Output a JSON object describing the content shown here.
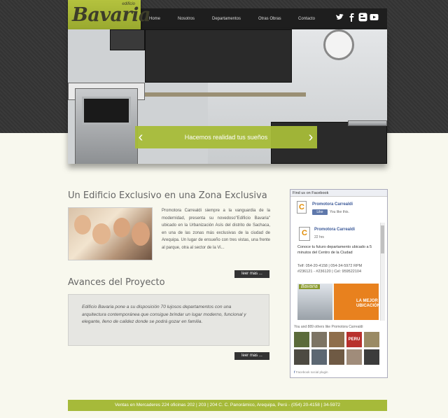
{
  "brand": {
    "name": "Bavaria",
    "tagline": "edificio"
  },
  "nav": {
    "items": [
      "Home",
      "Nosotros",
      "Departamentos",
      "Otras Obras",
      "Contacto"
    ]
  },
  "social": {
    "icons": [
      "twitter-icon",
      "facebook-icon",
      "blogger-icon",
      "youtube-icon"
    ]
  },
  "hero": {
    "caption": "Hacemos realidad tus sueños",
    "prev_arrow": "‹",
    "next_arrow": "›"
  },
  "section1": {
    "title": "Un Edificio Exclusivo en una Zona Exclusiva",
    "text": "Promotora Carrealdi siempre a la vanguardia de la modernidad, presenta su novedoso\"Edificio Bavaria\" ubicado en la Urbanización Asís del distrito de Sachaca, en una de las zonas más exclusivas de la ciudad de Arequipa. Un lugar de ensueño con tres vistas, una frente al parque, otra al sector de la Vi...",
    "button": "leer mas ..."
  },
  "section2": {
    "title": "Avances del Proyecto",
    "text": "Edificio Bavaria pone a su disposición 70 lujosos departamentos con una arquitectura contemporánea que consigue brindar un lugar moderno, funcional y elegante, lleno de calidez donde se podrá gozar en familia.",
    "button": "leer mas ..."
  },
  "facebook": {
    "header": "Find us on Facebook",
    "page_name": "Promotora Carrealdi",
    "like_label": "Like",
    "you_like": "You like this.",
    "post_author": "Promotora Carrealdi",
    "post_time": "22 hrs",
    "post_text": "Conoce tu futuro departamento ubicado a 5 minutos del Centro de la Ciudad",
    "post_contact": "Telf: 054-20-4158 | 054-34-5972 RPM #236121 - #236120 | Cel: 959522104",
    "ad_title": "Bavaria",
    "ad_badge": "LA MEJOR UBICACIÓN",
    "likes_text": "You and 889 others like Promotora Carrealdi",
    "plugin_text": "Facebook social plugin",
    "logo_letter": "C",
    "avatar_label": "PERU"
  },
  "footer": {
    "text": "Ventas en Mercaderes 224 oficinas 202 | 203 | 204 C. C. Panorámico, Arequipa, Perú - (054) 20-4158 | 34-5972"
  }
}
